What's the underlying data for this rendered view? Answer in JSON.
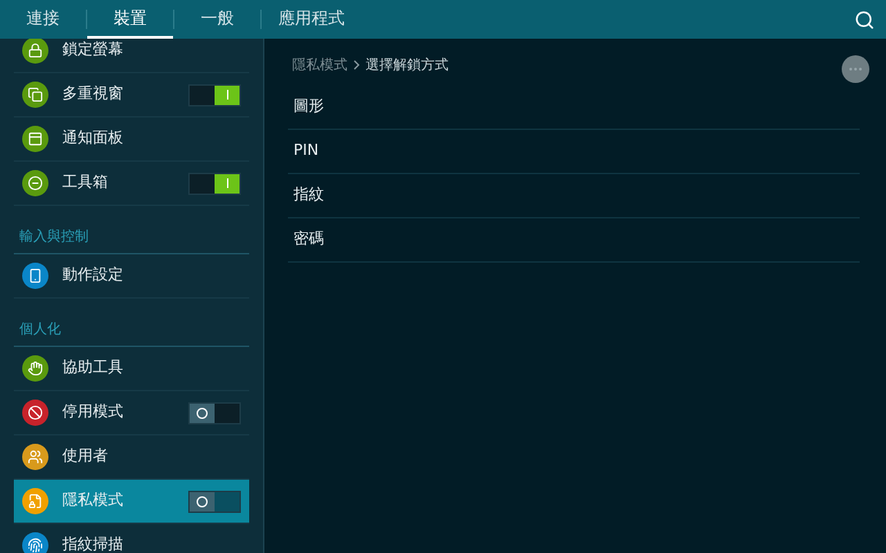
{
  "tabs": [
    {
      "label": "連接",
      "selected": false
    },
    {
      "label": "裝置",
      "selected": true
    },
    {
      "label": "一般",
      "selected": false
    },
    {
      "label": "應用程式",
      "selected": false
    }
  ],
  "sidebar": {
    "items": [
      {
        "kind": "item",
        "label": "鎖定螢幕",
        "color": "#5a9a0e",
        "selected": false
      },
      {
        "kind": "item",
        "label": "多重視窗",
        "color": "#5a9a0e",
        "selected": false,
        "toggle": {
          "on": true
        }
      },
      {
        "kind": "item",
        "label": "通知面板",
        "color": "#5a9a0e",
        "selected": false
      },
      {
        "kind": "item",
        "label": "工具箱",
        "color": "#5a9a0e",
        "selected": false,
        "toggle": {
          "on": true
        }
      },
      {
        "kind": "header",
        "label": "輸入與控制"
      },
      {
        "kind": "item",
        "label": "動作設定",
        "color": "#0a86c8",
        "selected": false
      },
      {
        "kind": "header",
        "label": "個人化"
      },
      {
        "kind": "item",
        "label": "協助工具",
        "color": "#5a9a0e",
        "selected": false
      },
      {
        "kind": "item",
        "label": "停用模式",
        "color": "#c8232b",
        "selected": false,
        "toggle": {
          "on": false
        }
      },
      {
        "kind": "item",
        "label": "使用者",
        "color": "#d89a1c",
        "selected": false
      },
      {
        "kind": "item",
        "label": "隱私模式",
        "color": "#f0a000",
        "selected": true,
        "toggle": {
          "on": false
        }
      },
      {
        "kind": "item",
        "label": "指紋掃描",
        "color": "#0a86c8",
        "selected": false
      }
    ]
  },
  "breadcrumb": {
    "parent": "隱私模式",
    "current": "選擇解鎖方式"
  },
  "options": [
    "圖形",
    "PIN",
    "指紋",
    "密碼"
  ]
}
